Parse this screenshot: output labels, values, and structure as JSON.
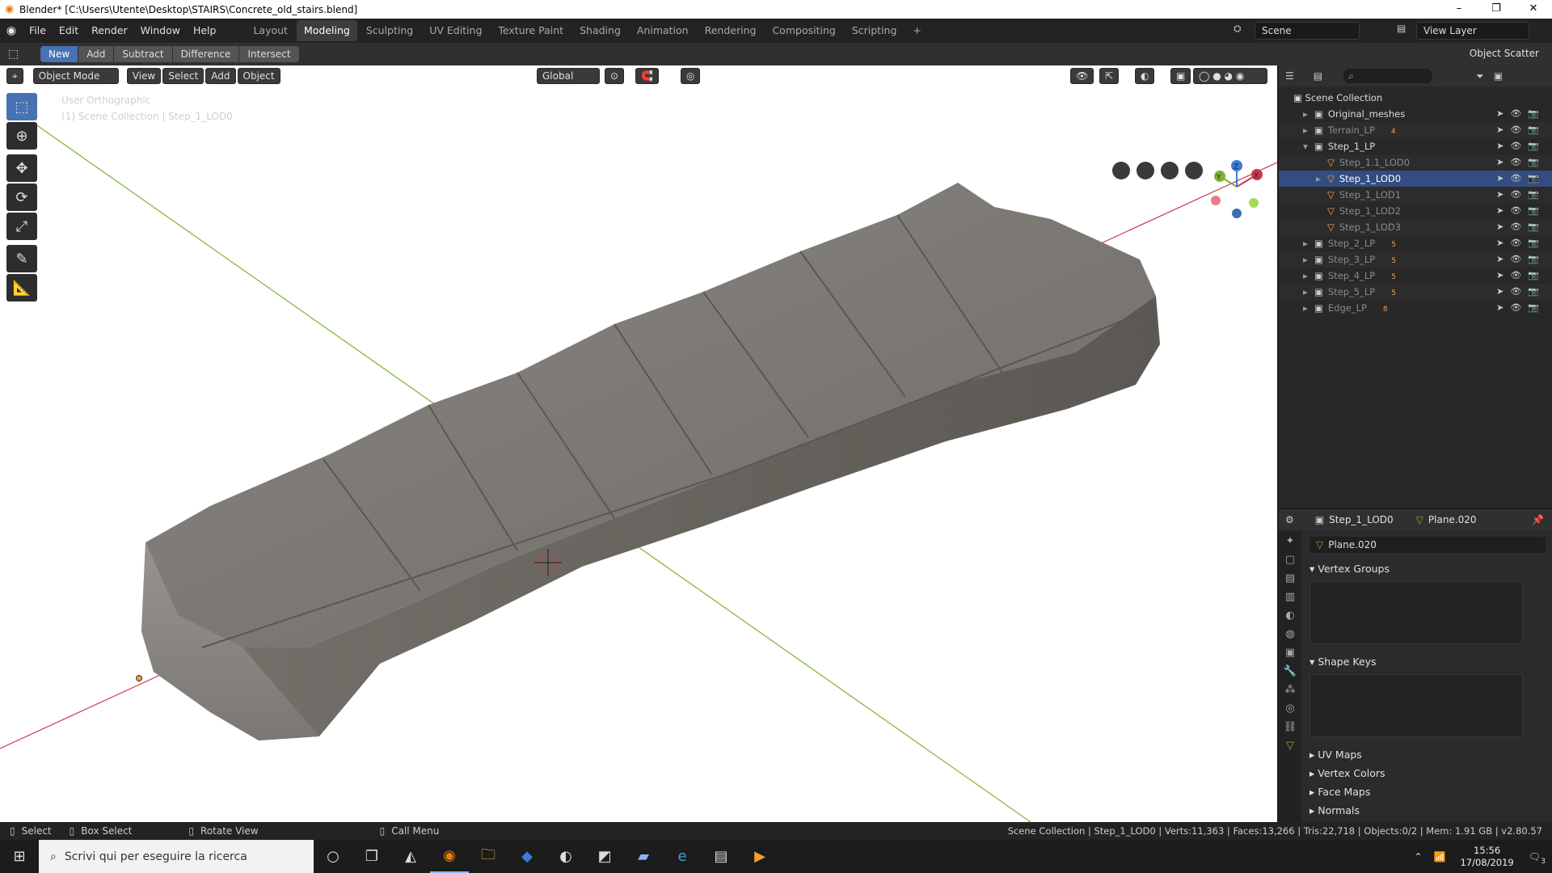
{
  "window": {
    "title": "Blender* [C:\\Users\\Utente\\Desktop\\STAIRS\\Concrete_old_stairs.blend]",
    "controls": [
      "–",
      "❐",
      "✕"
    ]
  },
  "menu": [
    "File",
    "Edit",
    "Render",
    "Window",
    "Help"
  ],
  "workspaces": [
    "Layout",
    "Modeling",
    "Sculpting",
    "UV Editing",
    "Texture Paint",
    "Shading",
    "Animation",
    "Rendering",
    "Compositing",
    "Scripting"
  ],
  "workspace_add": "+",
  "scene": {
    "name": "Scene",
    "view_layer": "View Layer"
  },
  "tool_header": {
    "modes": [
      "New",
      "Add",
      "Subtract",
      "Difference",
      "Intersect"
    ],
    "right_dropdown": "Object Scatter"
  },
  "viewport": {
    "mode": "Object Mode",
    "menus": [
      "View",
      "Select",
      "Add",
      "Object"
    ],
    "orientation": "Global",
    "overlay_title": "User Orthographic",
    "overlay_sub": "(1) Scene Collection | Step_1_LOD0",
    "gizmo": {
      "x": "X",
      "y": "Y",
      "z": "Z"
    }
  },
  "outliner": {
    "root": "Scene Collection",
    "rows": [
      {
        "label": "Original_meshes",
        "badge": "",
        "dim": false
      },
      {
        "label": "Terrain_LP",
        "badge": "4",
        "dim": true
      },
      {
        "label": "Step_1_LP",
        "badge": "",
        "dim": false
      },
      {
        "label": "Step_1.1_LOD0",
        "badge": "",
        "dim": true
      },
      {
        "label": "Step_1_LOD0",
        "badge": "",
        "dim": false
      },
      {
        "label": "Step_1_LOD1",
        "badge": "",
        "dim": true
      },
      {
        "label": "Step_1_LOD2",
        "badge": "",
        "dim": true
      },
      {
        "label": "Step_1_LOD3",
        "badge": "",
        "dim": true
      },
      {
        "label": "Step_2_LP",
        "badge": "5",
        "dim": true
      },
      {
        "label": "Step_3_LP",
        "badge": "5",
        "dim": true
      },
      {
        "label": "Step_4_LP",
        "badge": "5",
        "dim": true
      },
      {
        "label": "Step_5_LP",
        "badge": "5",
        "dim": true
      },
      {
        "label": "Edge_LP",
        "badge": "8",
        "dim": true
      }
    ]
  },
  "properties": {
    "object": "Step_1_LOD0",
    "mesh": "Plane.020",
    "mesh_field": "Plane.020",
    "sections": {
      "vertex_groups": "Vertex Groups",
      "shape_keys": "Shape Keys",
      "uv_maps": "UV Maps",
      "vertex_colors": "Vertex Colors",
      "face_maps": "Face Maps",
      "normals": "Normals"
    }
  },
  "status": {
    "select": "Select",
    "box_select": "Box Select",
    "rotate": "Rotate View",
    "call_menu": "Call Menu",
    "stats": "Scene Collection | Step_1_LOD0 | Verts:11,363 | Faces:13,266 | Tris:22,718 | Objects:0/2 | Mem: 1.91 GB | v2.80.57"
  },
  "taskbar": {
    "search_placeholder": "Scrivi qui per eseguire la ricerca",
    "time": "15:56",
    "date": "17/08/2019",
    "notif": "3"
  },
  "colors": {
    "accent": "#4772b3",
    "x_axis": "#c8384a",
    "y_axis": "#7eb235",
    "z_axis": "#3b7bd8",
    "viewport_bg": "#ffffff",
    "stone": "#7a7670"
  }
}
